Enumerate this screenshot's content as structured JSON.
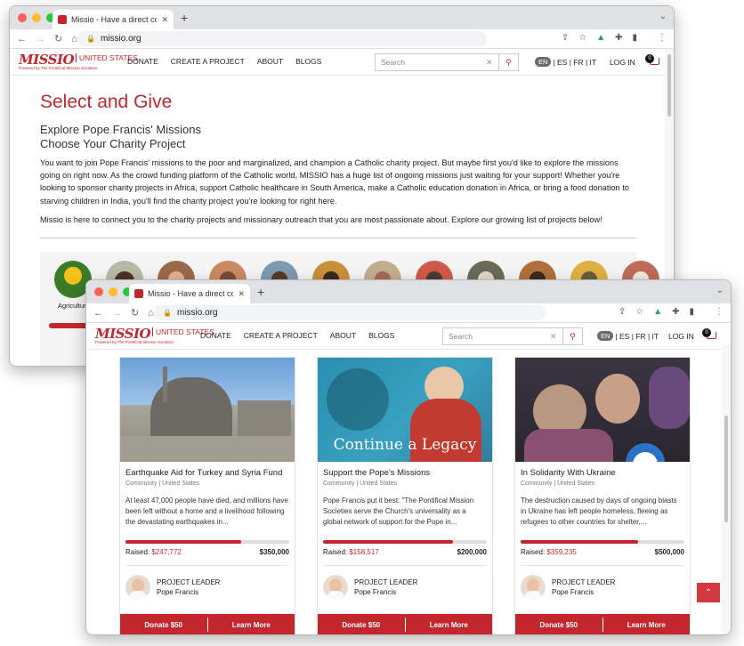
{
  "browser": {
    "tab_title": "Missio - Have a direct connect",
    "url": "missio.org"
  },
  "site": {
    "logo_main": "MISSIO",
    "logo_country": "UNITED STATES",
    "logo_sub": "Powered by The Pontifical Mission Societies",
    "menu": [
      "DONATE",
      "CREATE A PROJECT",
      "ABOUT",
      "BLOGS"
    ],
    "search_placeholder": "Search",
    "lang_active": "EN",
    "lang_others": "| ES | FR | IT",
    "login": "LOG IN",
    "cart_count": "0"
  },
  "page1": {
    "title": "Select and Give",
    "subtitle_1": "Explore Pope Francis' Missions",
    "subtitle_2": "Choose Your Charity Project",
    "para_1": "You want to join Pope Francis' missions to the poor and marginalized, and champion a Catholic charity project. But maybe first you'd like to explore the missions going on right now. As the crowd funding platform of the Catholic world, MISSIO has a huge list of ongoing missions just waiting for your support! Whether you're looking to sponsor charity projects in Africa, support Catholic healthcare in South America, make a Catholic education donation in Africa, or bring a food donation to starving children in India, you'll find the charity project you're looking for right here.",
    "para_2": "Missio is here to connect you to the charity projects and missionary outreach that you are most passionate about. Explore our growing list of projects below!",
    "category_label": "Agricultur"
  },
  "cards": [
    {
      "title": "Earthquake Aid for Turkey and Syria Fund",
      "meta": "Community | United States",
      "desc": "At least 47,000 people have died, and millions have been left without a home and a livelihood following the devastating earthquakes in...",
      "raised_label": "Raised:",
      "raised": "$247,772",
      "goal": "$350,000",
      "progress": 0.708,
      "leader_label": "PROJECT LEADER",
      "leader_name": "Pope Francis",
      "donate": "Donate $50",
      "learn": "Learn More"
    },
    {
      "title": "Support the Pope's Missions",
      "meta": "Community | United States",
      "desc": "Pope Francis put it best: \"The Pontifical Mission Societies serve the Church's universality as a global network of support for the Pope in...",
      "raised_label": "Raised:",
      "raised": "$158,517",
      "goal": "$200,000",
      "progress": 0.793,
      "leader_label": "PROJECT LEADER",
      "leader_name": "Pope Francis",
      "donate": "Donate $50",
      "learn": "Learn More",
      "image_caption": "Continue a Legacy"
    },
    {
      "title": "In Solidarity With Ukraine",
      "meta": "Community | United States",
      "desc": "The destruction caused by days of ongoing blasts in Ukraine has left people homeless, fleeing as refugees to other countries for shelter,...",
      "raised_label": "Raised:",
      "raised": "$359,235",
      "goal": "$500,000",
      "progress": 0.718,
      "leader_label": "PROJECT LEADER",
      "leader_name": "Pope Francis",
      "donate": "Donate $50",
      "learn": "Learn More"
    }
  ],
  "colors": {
    "brand": "#c4262e",
    "close_dot": "#fe5f57",
    "min_dot": "#febc2e",
    "max_dot": "#28c840"
  }
}
